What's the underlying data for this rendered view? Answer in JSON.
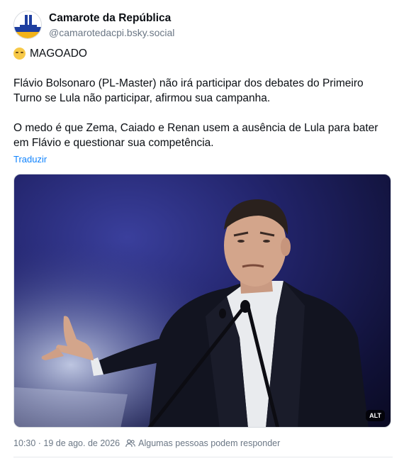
{
  "author": {
    "display_name": "Camarote da República",
    "handle": "@camarotedacpi.bsky.social",
    "avatar_icon": "camarote-logo"
  },
  "post": {
    "tag": "MAGOADO",
    "paragraph1": "Flávio Bolsonaro (PL-Master) não irá participar dos debates do Primeiro Turno se Lula não participar, afirmou sua campanha.",
    "paragraph2": "O medo é que Zema, Caiado e Renan usem a ausência de Lula para bater em Flávio e questionar sua competência.",
    "translate_label": "Traduzir"
  },
  "media": {
    "alt_badge": "ALT"
  },
  "meta": {
    "timestamp": "10:30 · 19 de ago. de 2026",
    "reply_setting": "Algumas pessoas podem responder"
  },
  "colors": {
    "link": "#1083fe",
    "secondary_text": "#6b7785",
    "background": "#ffffff"
  }
}
